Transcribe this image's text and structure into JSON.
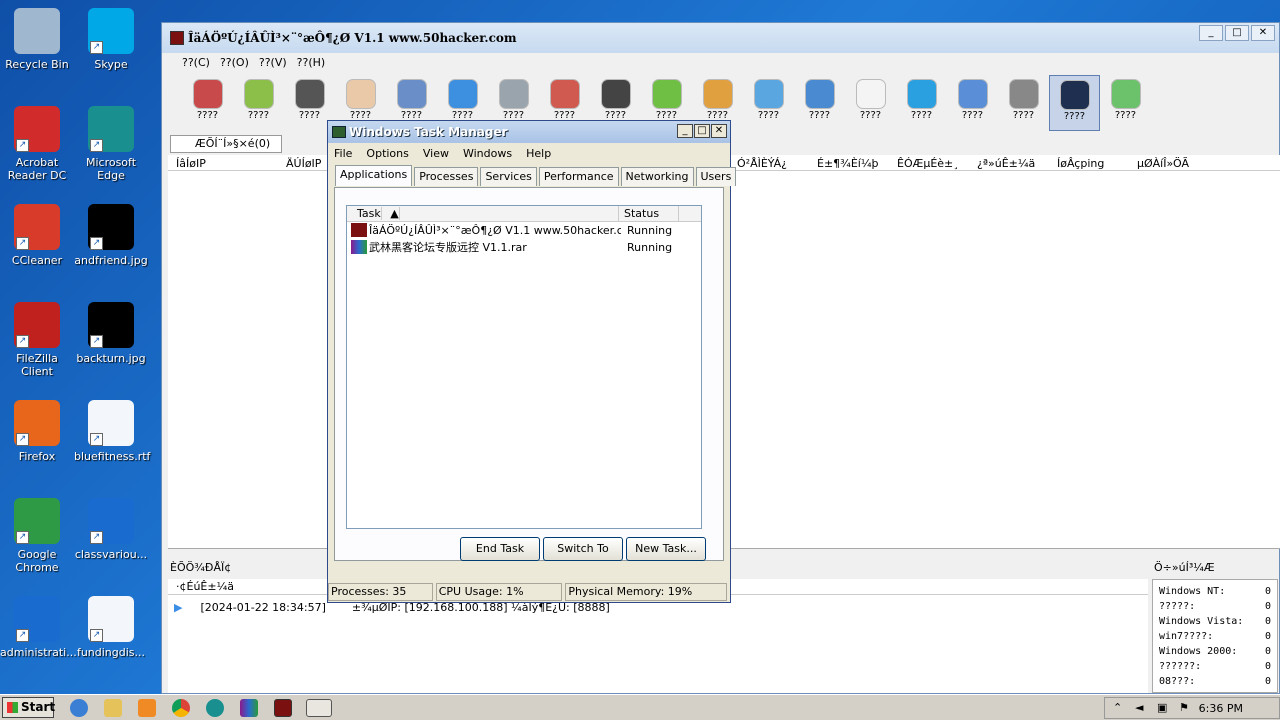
{
  "desktop": {
    "icons": [
      {
        "label": "Recycle Bin",
        "color": "#9fb8d0"
      },
      {
        "label": "Skype",
        "color": "#00a8e8"
      },
      {
        "label": "Acrobat Reader DC",
        "color": "#d12b2b"
      },
      {
        "label": "Microsoft Edge",
        "color": "#1a8f8f"
      },
      {
        "label": "CCleaner",
        "color": "#d83b2a"
      },
      {
        "label": "andfriend.jpg",
        "color": "#000000"
      },
      {
        "label": "FileZilla Client",
        "color": "#c0201e"
      },
      {
        "label": "backturn.jpg",
        "color": "#000000"
      },
      {
        "label": "Firefox",
        "color": "#e8651c"
      },
      {
        "label": "bluefitness.rtf",
        "color": "#f3f6fb"
      },
      {
        "label": "Google Chrome",
        "color": "#2f9a45"
      },
      {
        "label": "classvariou...",
        "color": "#1a6bd0"
      },
      {
        "label": "administrati...",
        "color": "#1a6bd0"
      },
      {
        "label": "fundingdis...",
        "color": "#f3f6fb"
      }
    ]
  },
  "app": {
    "title": "ÎäÁÖºÚ¿ÍÂÛÌ³×¨°æÔ¶¿Ø V1.1 www.50hacker.com",
    "menu": [
      "??(C)",
      "??(O)",
      "??(V)",
      "??(H)"
    ],
    "toolbar": [
      {
        "label": "????",
        "color": "#c94a4a"
      },
      {
        "label": "????",
        "color": "#8bbf4a"
      },
      {
        "label": "????",
        "color": "#555555"
      },
      {
        "label": "????",
        "color": "#e9c9a8"
      },
      {
        "label": "????",
        "color": "#6a8fc8"
      },
      {
        "label": "????",
        "color": "#3d8fe0"
      },
      {
        "label": "????",
        "color": "#9aa4ad"
      },
      {
        "label": "????",
        "color": "#d05a50"
      },
      {
        "label": "????",
        "color": "#444444"
      },
      {
        "label": "????",
        "color": "#6fbf45"
      },
      {
        "label": "????",
        "color": "#e0a040"
      },
      {
        "label": "????",
        "color": "#5aa6e0"
      },
      {
        "label": "????",
        "color": "#4a8ad0"
      },
      {
        "label": "????",
        "color": "#f4f4f4"
      },
      {
        "label": "????",
        "color": "#2aa0e0"
      },
      {
        "label": "????",
        "color": "#5a8ed6"
      },
      {
        "label": "????",
        "color": "#888888"
      },
      {
        "label": "????",
        "color": "#1f2f4f"
      },
      {
        "label": "????",
        "color": "#6cc26a"
      }
    ],
    "tab": "ÆÕÍ¨Í»§×é(0)",
    "columns": [
      "ÍâÍøIP",
      "ÄÚÍøIP",
      "Ó²ÅÌÈÝÁ¿",
      "É±¶¾Èí¼þ",
      "ÊÓÆµÉè±¸",
      "¿ª»úÊ±¼ä",
      "ÍøÂçping",
      "µØÀíÎ»ÖÃ"
    ],
    "log_title": "ÈÕÖ¾ÐÅÏ¢",
    "log_header": "·¢ÉúÊ±¼ä",
    "log_time": "[2024-01-22 18:34:57]",
    "log_text": "±¾µØIP: [192.168.100.188] ¼àÌý¶Ë¿Ú: [8888]",
    "stats_title": "Ö÷»úÍ³¼Æ",
    "stats": [
      {
        "label": "Windows NT:",
        "value": "0"
      },
      {
        "label": "?????:",
        "value": "0"
      },
      {
        "label": "Windows Vista:",
        "value": "0"
      },
      {
        "label": "win7????:",
        "value": "0"
      },
      {
        "label": "Windows 2000:",
        "value": "0"
      },
      {
        "label": "??????:",
        "value": "0"
      },
      {
        "label": "08???:",
        "value": "0"
      }
    ]
  },
  "taskmgr": {
    "title": "Windows Task Manager",
    "menu": [
      "File",
      "Options",
      "View",
      "Windows",
      "Help"
    ],
    "tabs": [
      "Applications",
      "Processes",
      "Services",
      "Performance",
      "Networking",
      "Users"
    ],
    "col_task": "Task",
    "col_status": "Status",
    "tasks": [
      {
        "name": "ÎäÁÖºÚ¿ÍÂÛÌ³×¨°æÔ¶¿Ø V1.1 www.50hacker.c...",
        "status": "Running"
      },
      {
        "name": "武林黑客论坛专版远控 V1.1.rar",
        "status": "Running"
      }
    ],
    "buttons": {
      "end": "End Task",
      "switch": "Switch To",
      "new": "New Task..."
    },
    "status": {
      "processes": "Processes: 35",
      "cpu": "CPU Usage: 1%",
      "memory": "Physical Memory: 19%"
    }
  },
  "taskbar": {
    "start": "Start",
    "clock": "6:36 PM"
  }
}
